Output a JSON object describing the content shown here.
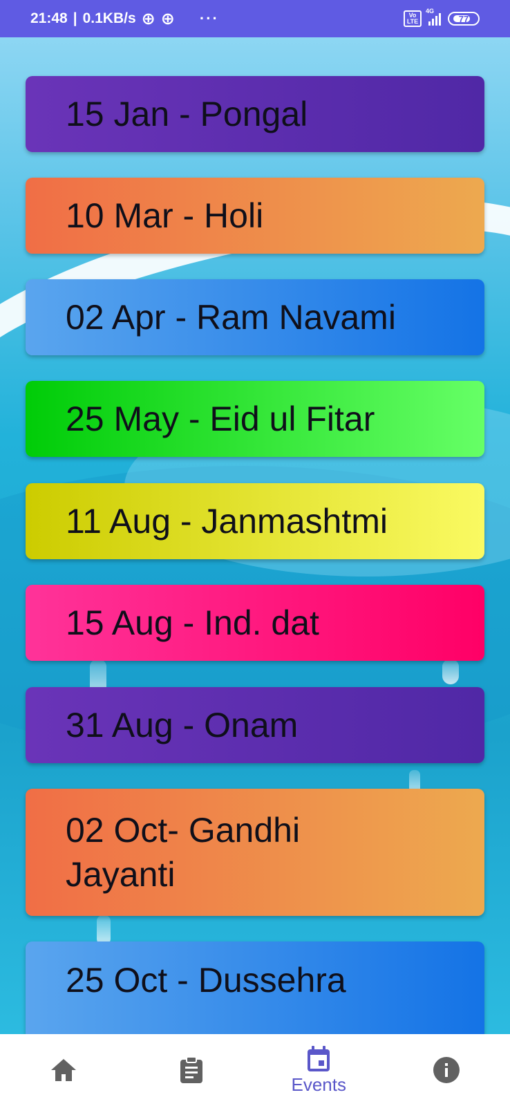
{
  "status_bar": {
    "time": "21:48",
    "speed": "0.1KB/s",
    "dots": "···",
    "volte": "Vo LTE",
    "network": "4G",
    "battery": "77"
  },
  "events": [
    {
      "label": "15 Jan -  Pongal",
      "gradient": [
        "#6a34b8",
        "#5028a6"
      ]
    },
    {
      "label": "10 Mar -  Holi",
      "gradient": [
        "#f06e46",
        "#eda94f"
      ]
    },
    {
      "label": "02 Apr -  Ram Navami",
      "gradient": [
        "#5aa5ee",
        "#1473e6"
      ]
    },
    {
      "label": "25 May -  Eid ul Fitar",
      "gradient": [
        "#00cc08",
        "#66ff66"
      ]
    },
    {
      "label": "11 Aug - Janmashtmi",
      "gradient": [
        "#cccc00",
        "#fafa62"
      ]
    },
    {
      "label": "15 Aug -  Ind. dat",
      "gradient": [
        "#ff3399",
        "#ff0066"
      ]
    },
    {
      "label": "31 Aug -  Onam",
      "gradient": [
        "#6a34b8",
        "#5028a6"
      ]
    },
    {
      "label": "02 Oct- Gandhi Jayanti",
      "gradient": [
        "#f06e46",
        "#eda94f"
      ]
    },
    {
      "label": "25 Oct -  Dussehra",
      "gradient": [
        "#5aa5ee",
        "#1473e6"
      ]
    }
  ],
  "bottom_nav": {
    "items": [
      {
        "icon": "home-icon",
        "label": ""
      },
      {
        "icon": "clipboard-icon",
        "label": ""
      },
      {
        "icon": "calendar-icon",
        "label": "Events"
      },
      {
        "icon": "info-icon",
        "label": ""
      }
    ],
    "active_color": "#5a57c9",
    "inactive_color": "#616161"
  }
}
